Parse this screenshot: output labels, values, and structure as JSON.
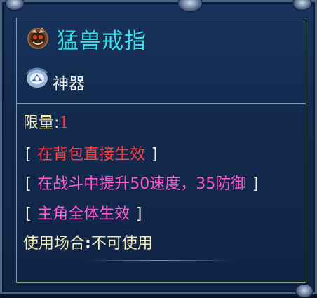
{
  "item": {
    "name": "猛兽戒指",
    "name_icon": "ring-icon",
    "type_label": "神器",
    "type_icon": "artifact-icon"
  },
  "stats": {
    "limit_label": "限量:",
    "limit_value": "1",
    "effect1": "在背包直接生效",
    "effect2": "在战斗中提升50速度，35防御",
    "effect3": "主角全体生效",
    "bracket_open": "[",
    "bracket_close": "]",
    "usage_label": "使用场合",
    "usage_colon": ":",
    "usage_value": "不可使用"
  },
  "colors": {
    "title": "#33e0f0",
    "limit_label": "#f3ecb4",
    "limit_value": "#ff3a3a",
    "effect_red": "#ff3e3e",
    "effect_pink": "#ff5ad0",
    "border": "#8a9d75",
    "background": "#132a4e"
  }
}
